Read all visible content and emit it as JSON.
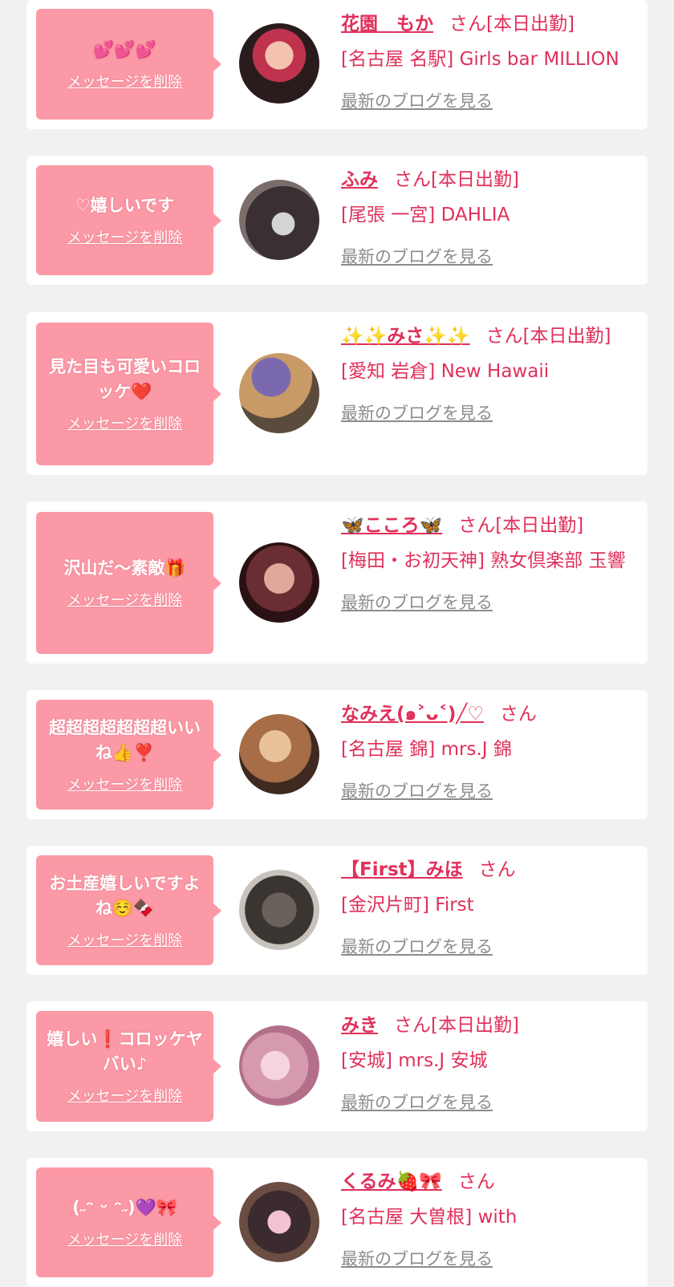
{
  "delete_label": "メッセージを削除",
  "blog_label": "最新のブログを見る",
  "items": [
    {
      "message": "💕💕💕",
      "name": "花園　もか",
      "suffix": "さん[本日出勤]",
      "shop": "[名古屋 名駅] Girls bar MILLION"
    },
    {
      "message": "♡嬉しいです",
      "name": "ふみ",
      "suffix": "さん[本日出勤]",
      "shop": "[尾張 一宮] DAHLIA"
    },
    {
      "message": "見た目も可愛いコロッケ❤️",
      "name": "✨✨みさ✨✨",
      "suffix": "さん[本日出勤]",
      "shop": "[愛知 岩倉] New Hawaii"
    },
    {
      "message": "沢山だ〜素敵🎁",
      "name": "🦋こころ🦋",
      "suffix": "さん[本日出勤]",
      "shop": "[梅田・お初天神] 熟女倶楽部 玉響"
    },
    {
      "message": "超超超超超超超いいね👍❣️",
      "name": "なみえ(๑˃ᴗ˂)╱♡",
      "suffix": "さん",
      "shop": "[名古屋 錦] mrs.J 錦"
    },
    {
      "message": "お土産嬉しいですよね☺️🍫",
      "name": "【First】みほ",
      "suffix": "さん",
      "shop": "[金沢片町] First"
    },
    {
      "message": "嬉しい❗️コロッケヤバい♪",
      "name": "みき",
      "suffix": "さん[本日出勤]",
      "shop": "[安城] mrs.J 安城"
    },
    {
      "message": "(˶ᵔ ᵕ ᵔ˶)💜🎀",
      "name": "くるみ🍓🎀",
      "suffix": "さん",
      "shop": "[名古屋 大曽根] with"
    }
  ]
}
